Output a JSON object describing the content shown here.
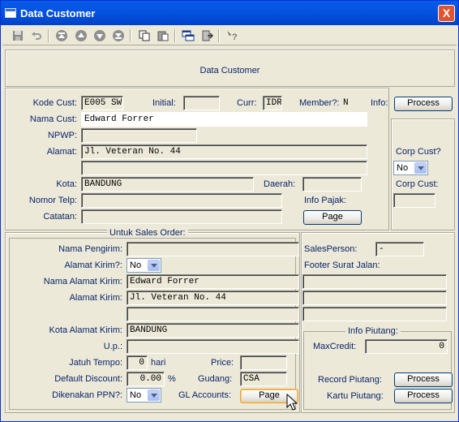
{
  "window": {
    "title": "Data Customer",
    "close": "X"
  },
  "header": {
    "title": "Data Customer"
  },
  "customer": {
    "kode_label": "Kode Cust:",
    "kode": "E005 SW",
    "initial_label": "Initial:",
    "initial": "",
    "curr_label": "Curr:",
    "curr": "IDR",
    "member_label": "Member?:",
    "member": "N",
    "info_label": "Info:",
    "info_button": "Process",
    "nama_label": "Nama Cust:",
    "nama": "Edward Forrer",
    "npwp_label": "NPWP:",
    "npwp": "",
    "alamat_label": "Alamat:",
    "alamat1": "Jl. Veteran No. 44",
    "alamat2": "",
    "kota_label": "Kota:",
    "kota": "BANDUNG",
    "daerah_label": "Daerah:",
    "daerah": "",
    "telp_label": "Nomor Telp:",
    "telp": "",
    "catatan_label": "Catatan:",
    "catatan": "",
    "pajak_label": "Info Pajak:",
    "pajak_button": "Page"
  },
  "corp": {
    "corp_label": "Corp Cust?",
    "corp_value": "No",
    "corp_cust_label": "Corp Cust:",
    "corp_cust": ""
  },
  "sales": {
    "group_title": "Untuk Sales Order:",
    "pengirim_label": "Nama Pengirim:",
    "pengirim": "",
    "alamat_kirim_q_label": "Alamat Kirim?:",
    "alamat_kirim_q": "No",
    "nama_alamat_label": "Nama Alamat Kirim:",
    "nama_alamat": "Edward Forrer",
    "alamat_kirim_label": "Alamat Kirim:",
    "alamat_kirim1": "Jl. Veteran No. 44",
    "alamat_kirim2": "",
    "kota_kirim_label": "Kota Alamat Kirim:",
    "kota_kirim": "BANDUNG",
    "up_label": "U.p.:",
    "up": "",
    "tempo_label": "Jatuh Tempo:",
    "tempo": "0",
    "tempo_unit": "hari",
    "price_label": "Price:",
    "price": "",
    "discount_label": "Default Discount:",
    "discount": "0.00",
    "discount_unit": "%",
    "gudang_label": "Gudang:",
    "gudang": "CSA",
    "ppn_label": "Dikenakan PPN?:",
    "ppn": "No",
    "gl_label": "GL Accounts:",
    "gl_button": "Page"
  },
  "right": {
    "salesperson_label": "SalesPerson:",
    "salesperson": "-",
    "footer_label": "Footer Surat Jalan:",
    "footer1": "",
    "footer2": "",
    "footer3": "",
    "piutang_title": "Info Piutang:",
    "maxcredit_label": "MaxCredit:",
    "maxcredit": "0",
    "record_label": "Record Piutang:",
    "record_button": "Process",
    "kartu_label": "Kartu Piutang:",
    "kartu_button": "Process"
  }
}
